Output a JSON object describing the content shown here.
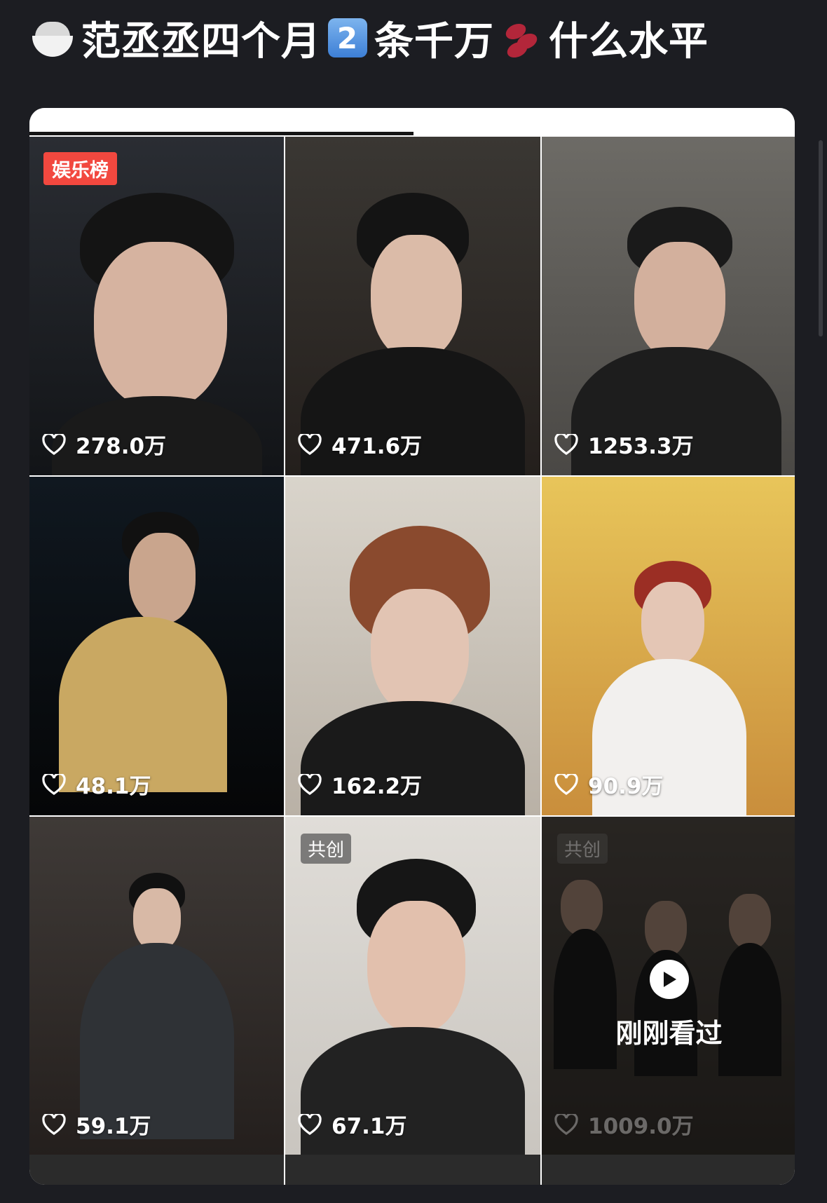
{
  "post": {
    "title_part1": "范丞丞四个月",
    "title_number_emoji": "2",
    "title_part2": "条千万",
    "title_part3": "什么水平",
    "emoji_icons": [
      "rice-bowl-icon",
      "keycap-digit-two-icon",
      "beans-icon"
    ]
  },
  "videos": [
    {
      "likes": "278.0万",
      "badge": "娱乐榜",
      "badge_type": "rank"
    },
    {
      "likes": "471.6万"
    },
    {
      "likes": "1253.3万"
    },
    {
      "likes": "48.1万"
    },
    {
      "likes": "162.2万"
    },
    {
      "likes": "90.9万"
    },
    {
      "likes": "59.1万"
    },
    {
      "likes": "67.1万",
      "badge": "共创",
      "badge_type": "cocreate"
    },
    {
      "likes": "1009.0万",
      "badge": "共创",
      "badge_type": "cocreate",
      "overlay_label": "刚刚看过"
    }
  ],
  "colors": {
    "page_background": "#1c1d22",
    "rank_badge": "#f2483f",
    "tab_indicator": "#151515"
  }
}
